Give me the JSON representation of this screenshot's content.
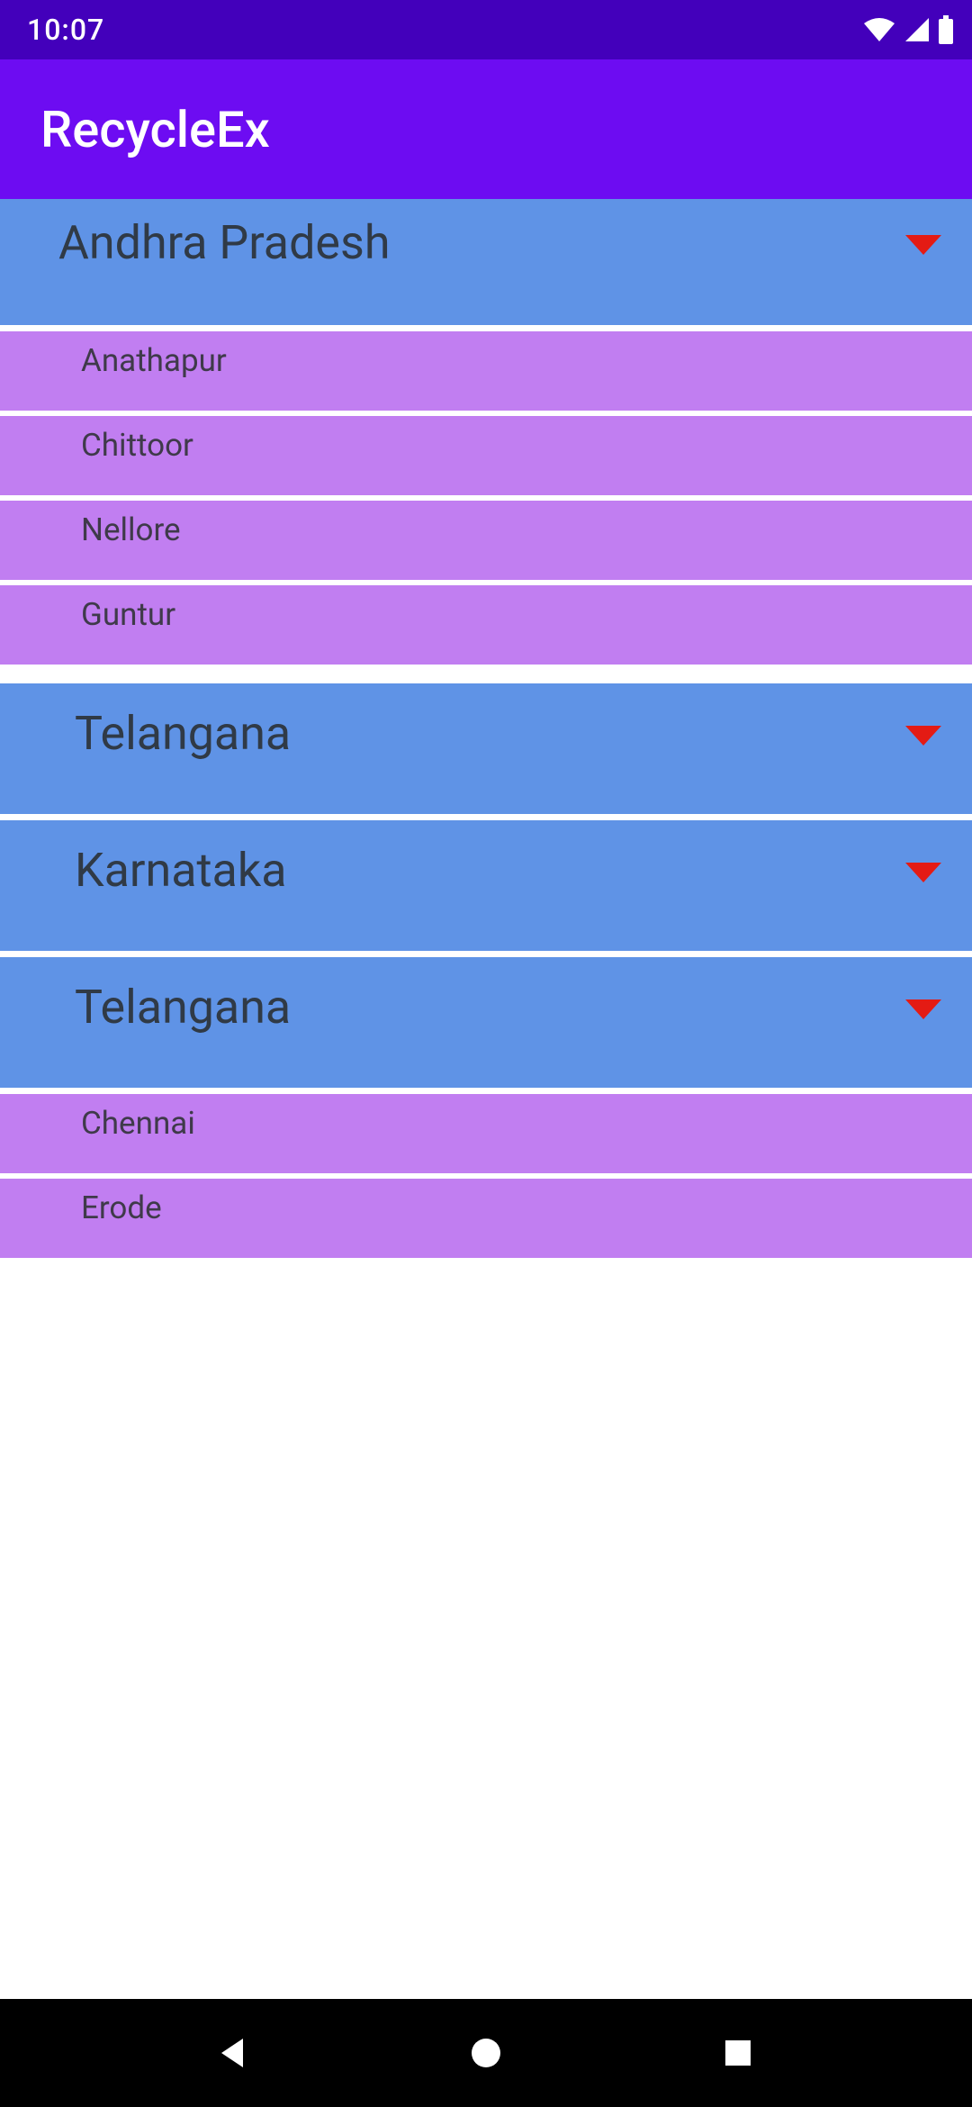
{
  "status_bar": {
    "time": "10:07"
  },
  "app_bar": {
    "title": "RecycleEx"
  },
  "colors": {
    "status_bg": "#4300bb",
    "app_bar_bg": "#6d0cf2",
    "group_bg": "#5f93e6",
    "child_bg": "#c17ef1",
    "chevron": "#e41b14"
  },
  "groups": [
    {
      "title": "Andhra Pradesh",
      "children": [
        {
          "label": "Anathapur"
        },
        {
          "label": "Chittoor"
        },
        {
          "label": "Nellore"
        },
        {
          "label": "Guntur"
        }
      ]
    },
    {
      "title": "Telangana",
      "children": []
    },
    {
      "title": "Karnataka",
      "children": []
    },
    {
      "title": "Telangana",
      "children": [
        {
          "label": "Chennai"
        },
        {
          "label": "Erode"
        }
      ]
    }
  ]
}
